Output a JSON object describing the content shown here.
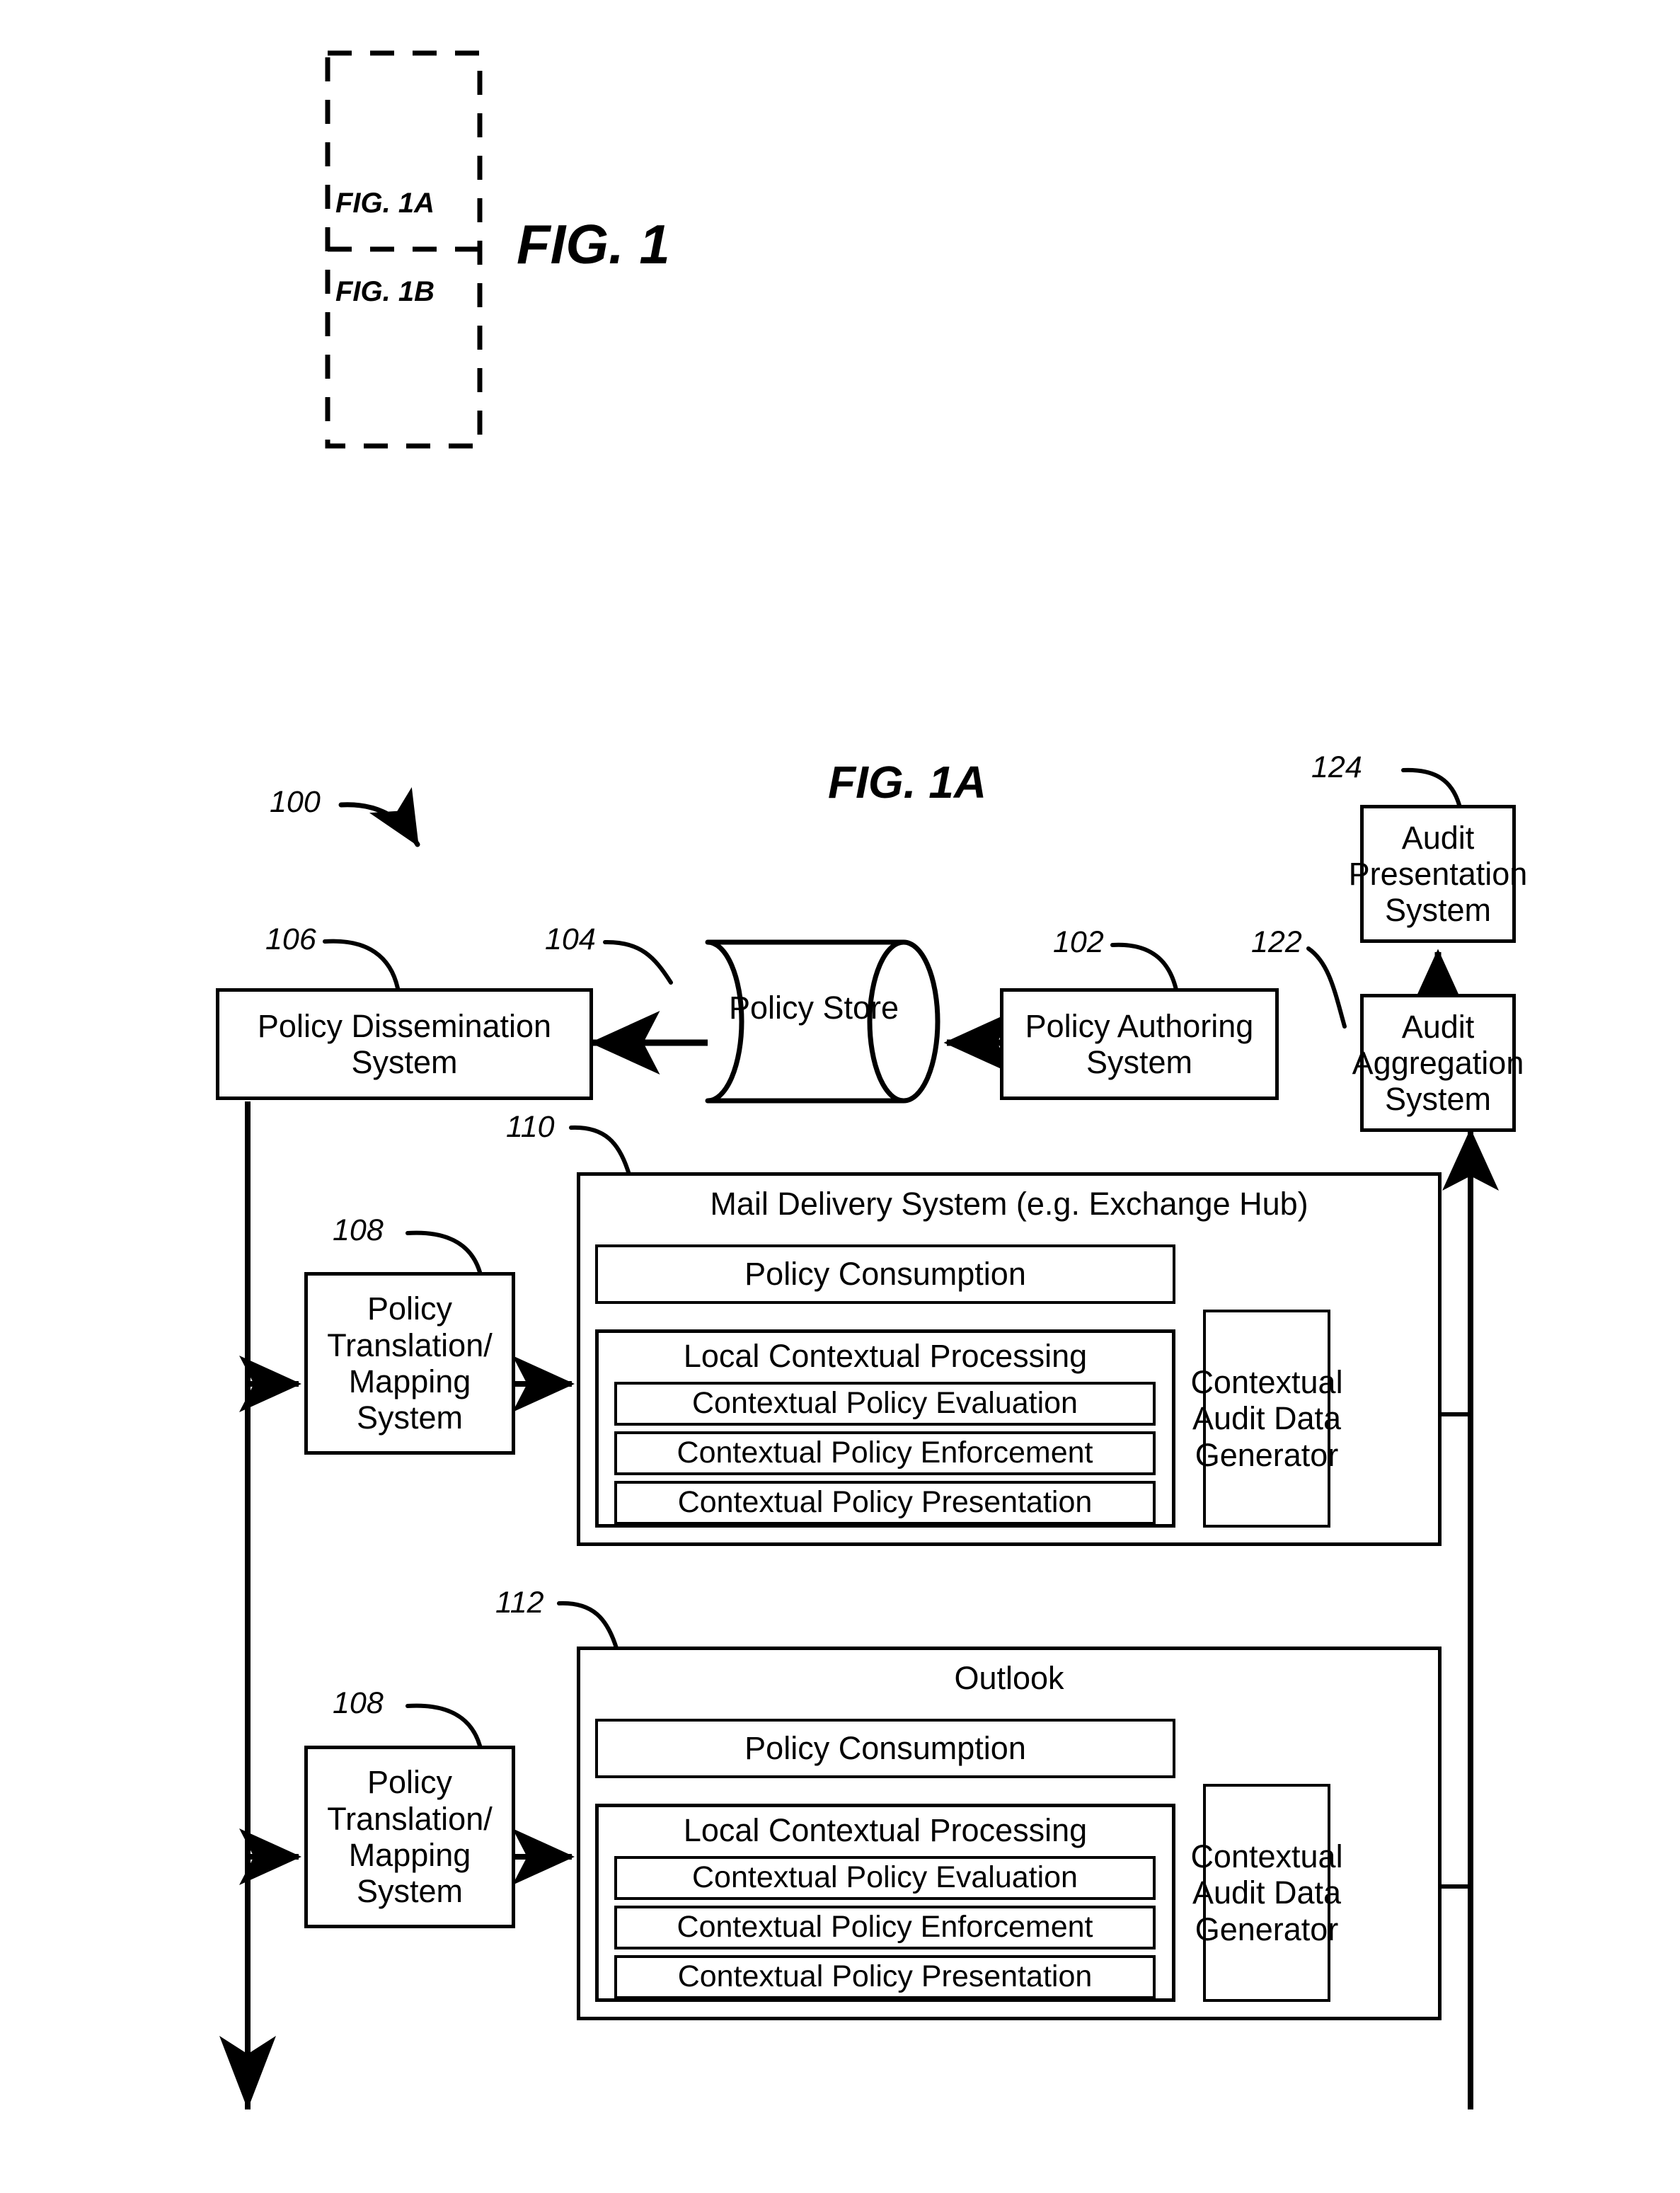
{
  "figure": {
    "main_title": "FIG. 1",
    "sheet_key": {
      "top_label": "FIG. 1A",
      "bottom_label": "FIG. 1B"
    },
    "subfigure_title": "FIG. 1A"
  },
  "reference_numerals": {
    "system": "100",
    "policy_authoring": "102",
    "policy_store": "104",
    "policy_dissemination": "106",
    "translation_upper": "108",
    "translation_lower": "108",
    "mail_delivery": "110",
    "outlook": "112",
    "audit_aggregation": "122",
    "audit_presentation": "124"
  },
  "nodes": {
    "policy_dissemination": "Policy Dissemination System",
    "policy_store": "Policy Store",
    "policy_authoring": "Policy Authoring System",
    "audit_presentation": "Audit Presentation System",
    "audit_aggregation": "Audit Aggregation System",
    "translation_upper": "Policy Translation/ Mapping System",
    "translation_lower": "Policy Translation/ Mapping System"
  },
  "clients": [
    {
      "id": "mail-delivery-system",
      "title": "Mail Delivery System (e.g. Exchange Hub)",
      "policy_consumption": "Policy Consumption",
      "local_processing_title": "Local Contextual Processing",
      "local_processing_items": [
        "Contextual Policy Evaluation",
        "Contextual Policy Enforcement",
        "Contextual Policy Presentation"
      ],
      "audit_generator": "Contextual Audit Data Generator"
    },
    {
      "id": "outlook",
      "title": "Outlook",
      "policy_consumption": "Policy Consumption",
      "local_processing_title": "Local Contextual Processing",
      "local_processing_items": [
        "Contextual Policy Evaluation",
        "Contextual Policy Enforcement",
        "Contextual Policy Presentation"
      ],
      "audit_generator": "Contextual Audit Data Generator"
    }
  ],
  "colors": {
    "ink": "#000000",
    "paper": "#ffffff"
  }
}
